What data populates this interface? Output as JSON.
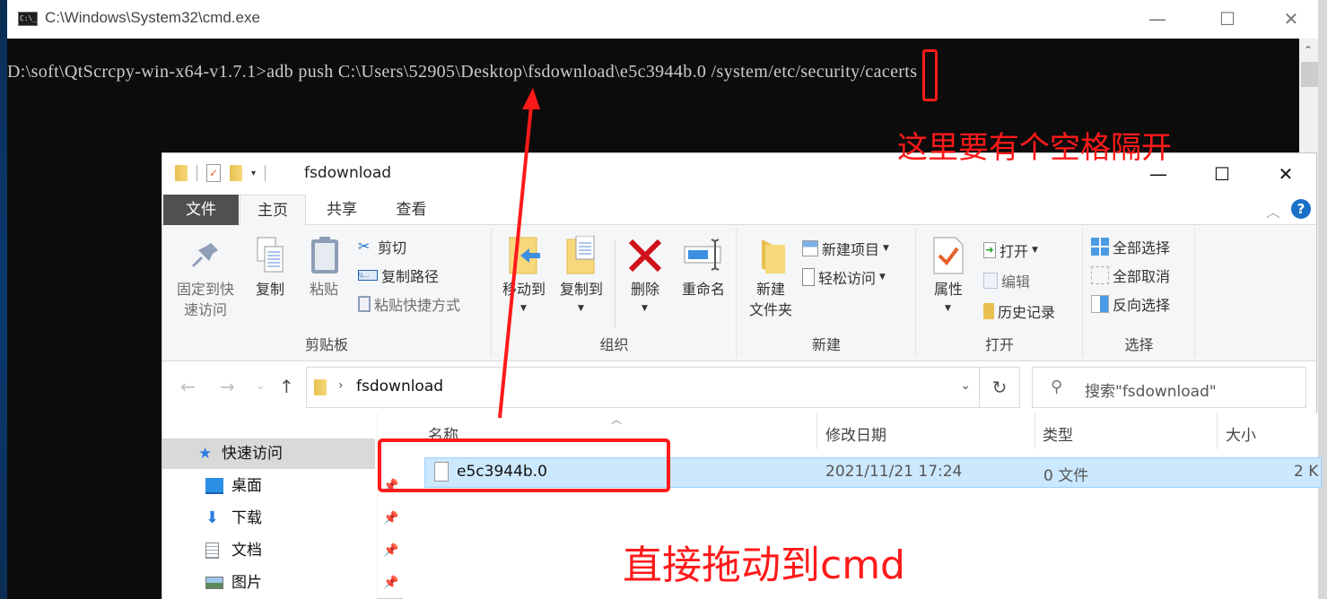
{
  "cmd": {
    "title": "C:\\Windows\\System32\\cmd.exe",
    "icon_label": "C:\\_",
    "controls": {
      "minimize": "—",
      "maximize": "☐",
      "close": "✕"
    },
    "command_line": "D:\\soft\\QtScrcpy-win-x64-v1.7.1>adb push C:\\Users\\52905\\Desktop\\fsdownload\\e5c3944b.0 /system/etc/security/cacerts",
    "scroll_up": "⌃"
  },
  "annotations": {
    "space_note": "这里要有个空格隔开",
    "drag_note": "直接拖动到cmd",
    "color": "#ff1a1a"
  },
  "explorer": {
    "title": "fsdownload",
    "qat_dropdown": "▾",
    "controls": {
      "minimize": "—",
      "maximize": "☐",
      "close": "✕"
    },
    "tabs": [
      {
        "label": "文件"
      },
      {
        "label": "主页"
      },
      {
        "label": "共享"
      },
      {
        "label": "查看"
      }
    ],
    "ribbon_collapse": "︿",
    "help": "?",
    "ribbon": {
      "clipboard": {
        "label": "剪贴板",
        "pin": "固定到快速访问",
        "pin_line1": "固定到快",
        "pin_line2": "速访问",
        "copy": "复制",
        "paste": "粘贴",
        "cut": "剪切",
        "copy_path": "复制路径",
        "paste_shortcut": "粘贴快捷方式"
      },
      "organize": {
        "label": "组织",
        "move_to": "移动到",
        "copy_to": "复制到",
        "delete": "删除",
        "rename": "重命名"
      },
      "new": {
        "label": "新建",
        "new_folder_line1": "新建",
        "new_folder_line2": "文件夹",
        "new_item": "新建项目",
        "easy_access": "轻松访问"
      },
      "open": {
        "label": "打开",
        "properties": "属性",
        "open": "打开",
        "edit": "编辑",
        "history": "历史记录"
      },
      "select": {
        "label": "选择",
        "select_all": "全部选择",
        "select_none": "全部取消",
        "invert": "反向选择"
      }
    },
    "nav": {
      "back": "←",
      "forward": "→",
      "recent": "⌄",
      "up": "↑",
      "path": "fsdownload",
      "breadcrumb_chevron": "›",
      "address_dropdown": "⌄",
      "refresh": "↻",
      "search_placeholder": "搜索\"fsdownload\""
    },
    "sidebar": {
      "items": [
        {
          "label": "快速访问",
          "pinned": false,
          "selected": true
        },
        {
          "label": "桌面",
          "pinned": true
        },
        {
          "label": "下载",
          "pinned": true
        },
        {
          "label": "文档",
          "pinned": true
        },
        {
          "label": "图片",
          "pinned": true
        }
      ]
    },
    "columns": [
      {
        "label": "名称"
      },
      {
        "label": "修改日期"
      },
      {
        "label": "类型"
      },
      {
        "label": "大小"
      }
    ],
    "files": [
      {
        "name": "e5c3944b.0",
        "modified": "2021/11/21 17:24",
        "type": "0 文件",
        "size": "2 K",
        "selected": true
      }
    ]
  }
}
